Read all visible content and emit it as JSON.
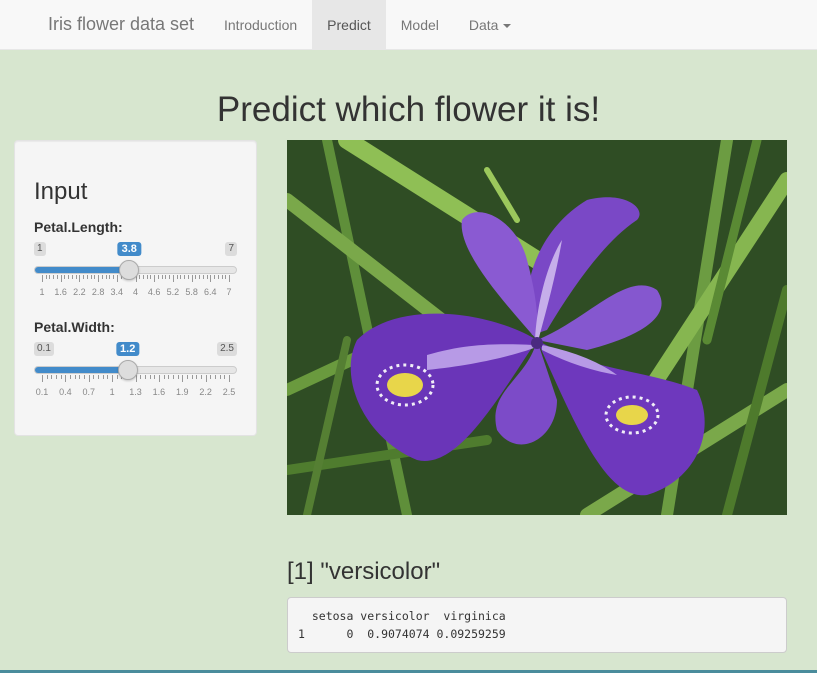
{
  "navbar": {
    "brand": "Iris flower data set",
    "items": [
      {
        "label": "Introduction",
        "active": false
      },
      {
        "label": "Predict",
        "active": true
      },
      {
        "label": "Model",
        "active": false
      },
      {
        "label": "Data",
        "active": false,
        "dropdown": true
      }
    ]
  },
  "page": {
    "title": "Predict which flower it is!"
  },
  "sidebar": {
    "heading": "Input",
    "sliders": [
      {
        "label": "Petal.Length:",
        "min": 1,
        "max": 7,
        "value": 3.8,
        "min_label": "1",
        "max_label": "7",
        "value_label": "3.8",
        "tick_labels": [
          "1",
          "1.6",
          "2.2",
          "2.8",
          "3.4",
          "4",
          "4.6",
          "5.2",
          "5.8",
          "6.4",
          "7"
        ]
      },
      {
        "label": "Petal.Width:",
        "min": 0.1,
        "max": 2.5,
        "value": 1.2,
        "min_label": "0.1",
        "max_label": "2.5",
        "value_label": "1.2",
        "tick_labels": [
          "0.1",
          "0.4",
          "0.7",
          "1",
          "1.3",
          "1.6",
          "1.9",
          "2.2",
          "2.5"
        ]
      }
    ]
  },
  "output": {
    "prediction": "[1] \"versicolor\"",
    "table_header": "  setosa versicolor  virginica",
    "table_row": "1      0  0.9074074 0.09259259"
  },
  "colors": {
    "accent": "#428bca",
    "page_bg": "#d7e6cf",
    "navbar_bg": "#f8f8f8"
  },
  "icons": {
    "dropdown": "caret-down-icon",
    "photo": "iris-flower-photo"
  }
}
